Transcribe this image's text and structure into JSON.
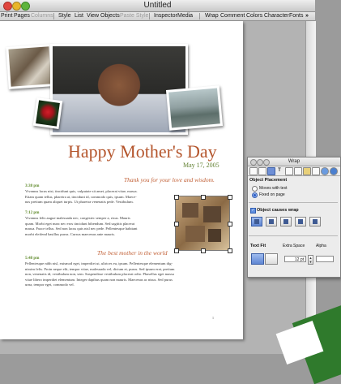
{
  "window": {
    "title": "Untitled"
  },
  "toolbar": {
    "left": [
      {
        "label": "Print",
        "enabled": true
      },
      {
        "label": "Pages",
        "enabled": true
      },
      {
        "label": "Columns",
        "enabled": false
      },
      {
        "label": "Style",
        "enabled": true
      },
      {
        "label": "List",
        "enabled": true
      },
      {
        "label": "View",
        "enabled": true
      },
      {
        "label": "Objects",
        "enabled": true
      },
      {
        "label": "Paste Style",
        "enabled": false
      },
      {
        "label": "Inspector",
        "enabled": true
      },
      {
        "label": "Media",
        "enabled": true
      }
    ],
    "right": [
      "Wrap",
      "Comment",
      "Colors",
      "Character",
      "Fonts"
    ],
    "overflow": "»"
  },
  "document": {
    "heading": "Happy Mother's Day",
    "date": "May 17, 2005",
    "quote1": "Thank you for your love and wisdom.",
    "quote2": "The best mother in the world",
    "entries": [
      {
        "time": "3:38 pm",
        "lines": [
          "Vivamus lacus nisi, tincidunt quis, vulputate sit amet, placerat vitae, massa.",
          "Etiam quam tellus, pharetra at, tincidunt id, commodo quis, ipsum. Maece-",
          "nas pretium quam aliquet turpis. Ut pharetra venenatis pede. Vestibulum."
        ]
      },
      {
        "time": "7:12 pm",
        "lines": [
          "Vivamus felis augue malesuada nec, congestec semper a, risus. Mauris",
          "quam. Morbi eget nunc nec eros tincidunt bibendum. Sed sagittis placerat",
          "massa. Fusce tellus. Sed non lacus quis nisl nec pede. Pellentesque habitant",
          "morbi eleifend basillus purus. Cursus maecenas ante mauris."
        ]
      },
      {
        "time": "5:48 pm",
        "lines": [
          "Pellentesque nibh nisl, euismod eget, imperdiet ut, ultrices eu, ipsum. Pellentesque elementum dig-",
          "nissim felis. Proin neque elit, tempor vitae, malesuada vel, dictum et, purus. Sed ipsum erat, pretium",
          "non, venenatis id, vestibulum non, sem. Suspendisse vestibulum placerat odio. Phasellus eget massa",
          "vitae libero imperdiet elementum. Integer dapibus quam non mauris. Maecenas ac nisus. Sed purus",
          "urna, tempor eget, commodo vel."
        ]
      }
    ],
    "page_number": "1"
  },
  "inspector": {
    "title": "Wrap",
    "section_placement": "Object Placement",
    "option_moves": "Moves with text",
    "option_fixed": "Fixed on page",
    "placement_selected": "Fixed on page",
    "causes_wrap_label": "Object causes wrap",
    "causes_wrap_checked": true,
    "text_fit_label": "Text Fit",
    "extra_space_label": "Extra Space",
    "alpha_label": "Alpha",
    "extra_space_value": "12 pt",
    "tabs": [
      "document-icon",
      "layout-icon",
      "wrap-icon",
      "text-icon",
      "graphic-icon",
      "metrics-icon",
      "table-icon",
      "chart-icon",
      "link-icon",
      "quicktime-icon"
    ],
    "selected_tab_index": 2
  },
  "colors": {
    "accent": "#b4552c",
    "green": "#5f7f2f",
    "selection": "#5f86d3"
  }
}
